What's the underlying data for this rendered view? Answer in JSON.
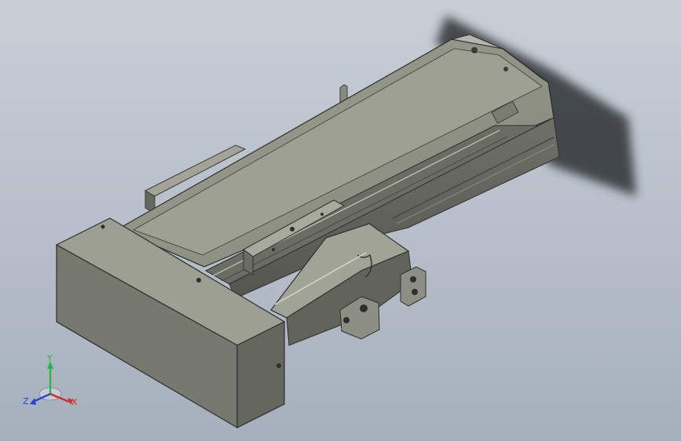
{
  "viewport": {
    "background_top": "#c9ced6",
    "background_bottom": "#a6b0bd"
  },
  "model": {
    "body_color": "#8f9083",
    "dark_color": "#5b5c55",
    "light_color": "#b4b5ab",
    "shadow_color": "#2f3234"
  },
  "triad": {
    "x_label": "X",
    "y_label": "Y",
    "z_label": "Z",
    "x_color": "#d42a2a",
    "y_color": "#2bb64a",
    "z_color": "#2a44d4"
  }
}
